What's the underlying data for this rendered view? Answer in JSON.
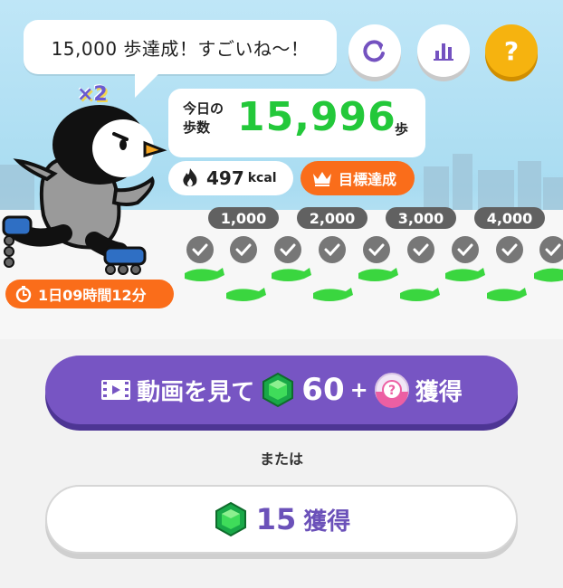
{
  "speech": {
    "text": "15,000 歩達成！すごいね〜！"
  },
  "header_buttons": [
    {
      "name": "refresh-icon"
    },
    {
      "name": "bar-chart-icon"
    },
    {
      "name": "help-icon",
      "label": "?"
    }
  ],
  "multiplier": "×2",
  "steps": {
    "label": "今日の歩数",
    "value": "15,996",
    "unit": "歩"
  },
  "calories": {
    "value": "497",
    "unit": "kcal"
  },
  "goal": {
    "label": "目標達成"
  },
  "milestones": [
    "1,000",
    "2,000",
    "3,000",
    "4,000"
  ],
  "timer": {
    "text": "1日09時間12分"
  },
  "video_reward": {
    "label": "動画を見て",
    "amount": "60",
    "plus": "+",
    "get": "獲得"
  },
  "or_text": "または",
  "gem_reward": {
    "amount": "15",
    "get": "獲得"
  },
  "colors": {
    "accent_purple": "#7755c3",
    "step_green": "#23c83a",
    "orange": "#fa6d1a",
    "help_yellow": "#f6b30f"
  }
}
